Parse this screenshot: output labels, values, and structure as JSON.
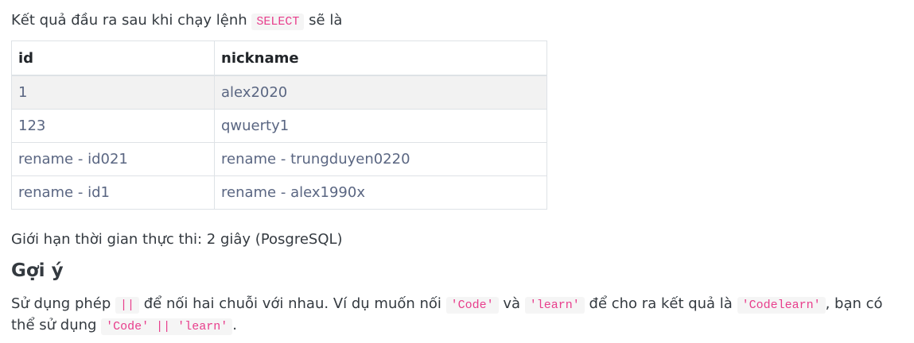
{
  "intro": {
    "before": "Kết quả đầu ra sau khi chạy lệnh ",
    "code": "SELECT",
    "after": " sẽ là"
  },
  "table": {
    "headers": [
      "id",
      "nickname"
    ],
    "rows": [
      [
        "1",
        "alex2020"
      ],
      [
        "123",
        "qwuerty1"
      ],
      [
        "rename - id021",
        "rename - trungduyen0220"
      ],
      [
        "rename - id1",
        "rename - alex1990x"
      ]
    ]
  },
  "time_limit": "Giới hạn thời gian thực thi: 2 giây (PosgreSQL)",
  "hint": {
    "title": "Gợi ý",
    "t1": "Sử dụng phép ",
    "code1": "||",
    "t2": " để nối hai chuỗi với nhau. Ví dụ muốn nối ",
    "code2": "'Code'",
    "t3": " và ",
    "code3": "'learn'",
    "t4": " để cho ra kết quả là ",
    "code4": "'Codelearn'",
    "t5": ", bạn có thể sử dụng ",
    "code5": "'Code' || 'learn'",
    "t6": "."
  }
}
